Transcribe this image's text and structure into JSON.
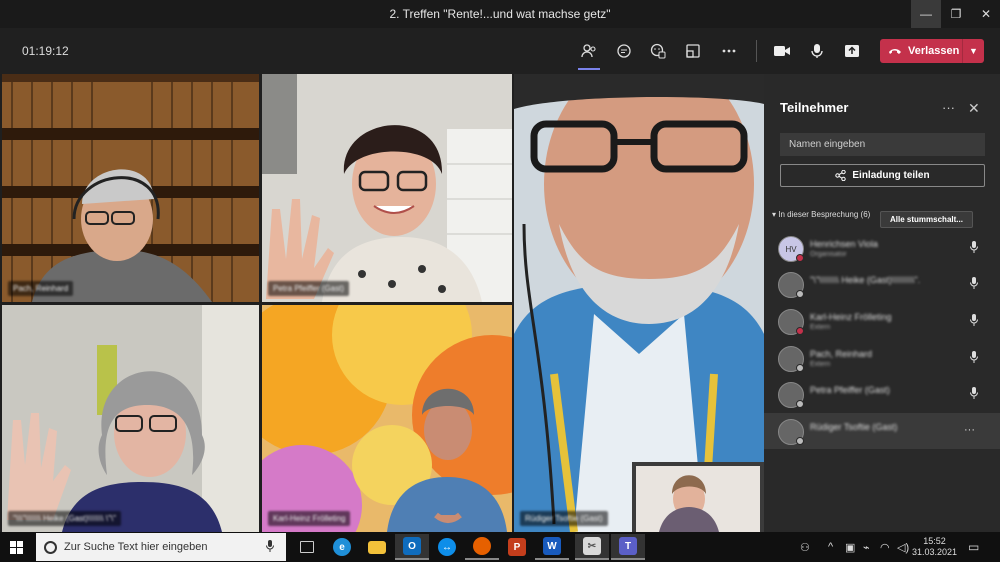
{
  "window": {
    "title": "2. Treffen \"Rente!...und wat machse getz\"",
    "minimize_glyph": "—",
    "maximize_glyph": "❐",
    "close_glyph": "✕"
  },
  "toolbar": {
    "timer": "01:19:12",
    "icons": [
      "participants-icon",
      "chat-icon",
      "reactions-icon",
      "rooms-icon",
      "more-icon",
      "camera-icon",
      "microphone-icon",
      "share-icon"
    ],
    "leave_label": "Verlassen",
    "leave_color": "#c4314b"
  },
  "tiles": [
    {
      "name": "Pach, Reinhard"
    },
    {
      "name": "Petra Pfeiffer (Gast)"
    },
    {
      "name": "Rüdiger Tsoftie (Gast)"
    },
    {
      "name": "\"\\\\\\\"\\\\\\\\\\\\\\ Heike (Gast)\\\\\\\\\\\\\\ \\\"\\\""
    },
    {
      "name": "Karl-Heinz Frölleting"
    }
  ],
  "panel": {
    "title": "Teilnehmer",
    "more_glyph": "···",
    "close_glyph": "✕",
    "search_placeholder": "Namen eingeben",
    "invite_label": "Einladung teilen",
    "section_label": "In dieser Besprechung (6)",
    "mute_all_label": "Alle stummschalt...",
    "participants": [
      {
        "initials": "HV",
        "name": "Henrichsen Viola",
        "role": "Organisator",
        "status": "red",
        "mic": true
      },
      {
        "initials": "",
        "name": "\"\\\"\\\\\\\\\\\\\\\\ Heike (Gast)\\\\\\\\\\\\\\\\\\\".",
        "role": "",
        "status": "grey",
        "mic": true
      },
      {
        "initials": "",
        "name": "Karl-Heinz Frölleting",
        "role": "Extern",
        "status": "red",
        "mic": true
      },
      {
        "initials": "",
        "name": "Pach, Reinhard",
        "role": "Extern",
        "status": "grey",
        "mic": true
      },
      {
        "initials": "",
        "name": "Petra Pfeiffer (Gast)",
        "role": "",
        "status": "grey",
        "mic": true
      },
      {
        "initials": "",
        "name": "Rüdiger Tsoftie (Gast)",
        "role": "",
        "status": "grey",
        "mic": false
      }
    ]
  },
  "taskbar": {
    "search_placeholder": "Zur Suche Text hier eingeben",
    "time": "15:52",
    "date": "31.03.2021",
    "apps": [
      "task-view",
      "edge",
      "file-explorer",
      "outlook",
      "teamviewer",
      "firefox",
      "powerpoint",
      "word",
      "snipping-tool",
      "teams"
    ]
  }
}
